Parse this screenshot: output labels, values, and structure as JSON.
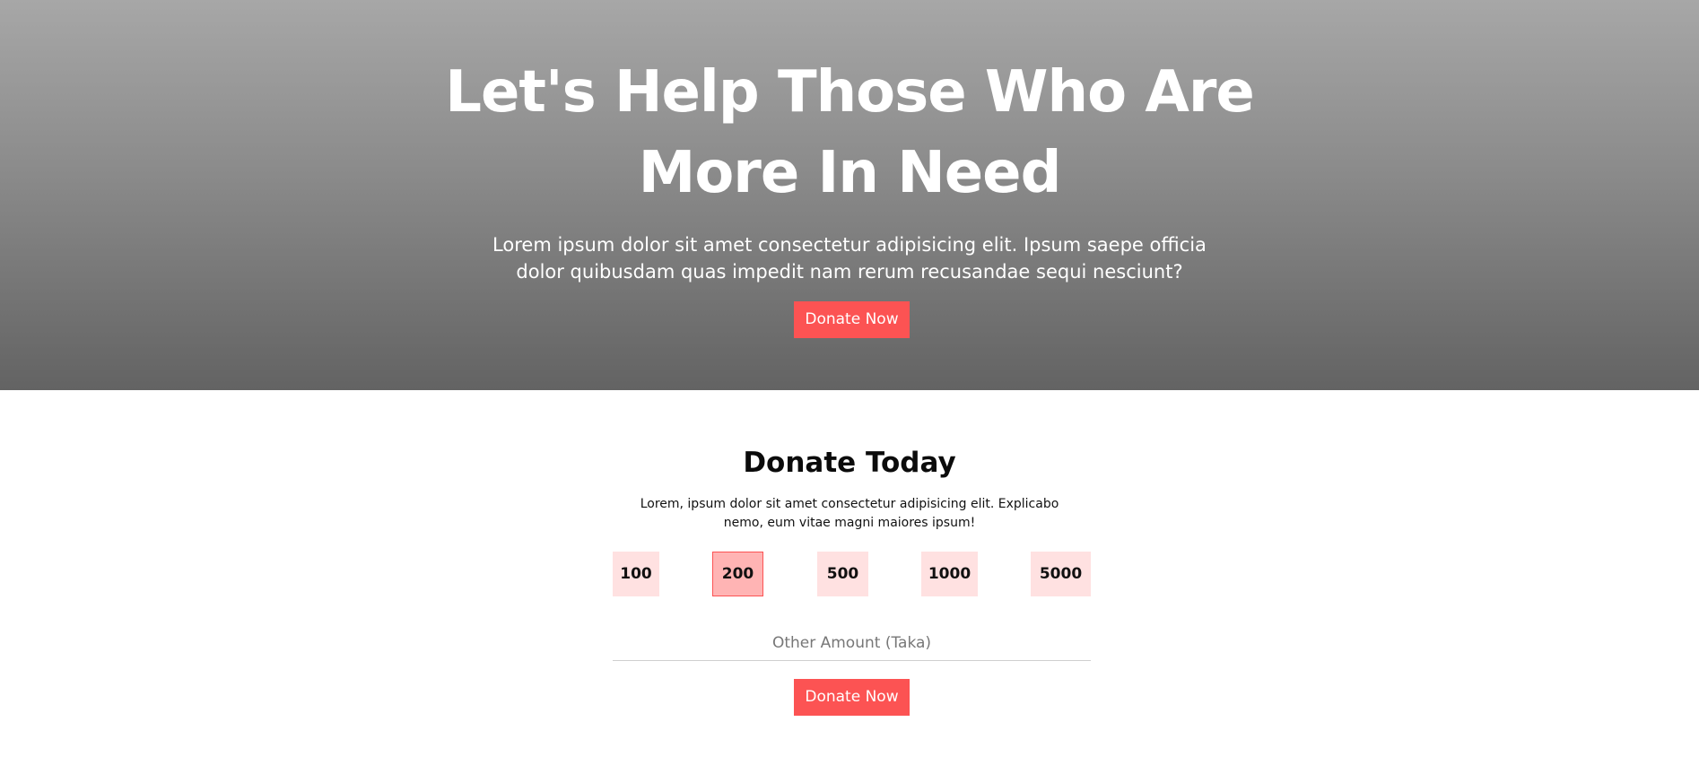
{
  "hero": {
    "title_line1": "Let's Help Those Who Are",
    "title_line2": "More In Need",
    "subtitle": "Lorem ipsum dolor sit amet consectetur adipisicing elit. Ipsum saepe officia dolor quibusdam quas impedit nam rerum recusandae sequi nesciunt?",
    "button_label": "Donate Now"
  },
  "donate": {
    "title": "Donate Today",
    "subtitle": "Lorem, ipsum dolor sit amet consectetur adipisicing elit. Explicabo nemo, eum vitae magni maiores ipsum!",
    "amounts": [
      "100",
      "200",
      "500",
      "1000",
      "5000"
    ],
    "selected_amount": "200",
    "other_amount_placeholder": "Other Amount (Taka)",
    "other_amount_value": "",
    "button_label": "Donate Now"
  },
  "colors": {
    "accent": "#fc5353",
    "amount_bg": "#ffe1e1",
    "amount_selected_bg": "#ffb4b4"
  }
}
